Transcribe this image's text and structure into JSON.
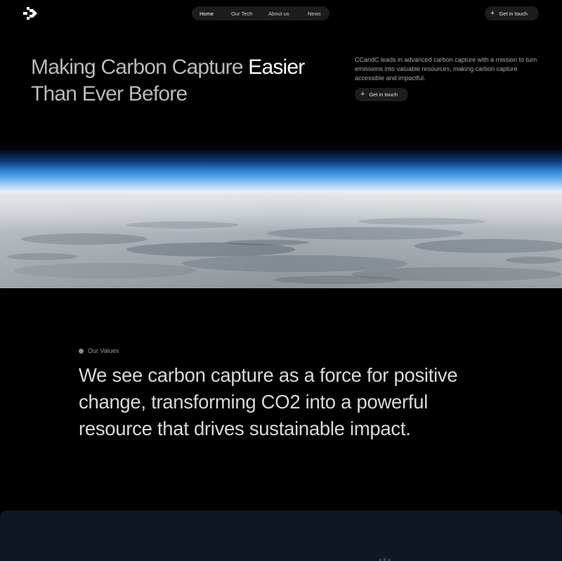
{
  "brand": {
    "logo_icon": "arrow-logo-icon"
  },
  "nav": {
    "items": [
      {
        "label": "Home",
        "active": true
      },
      {
        "label": "Our Tech",
        "active": false
      },
      {
        "label": "About us",
        "active": false
      },
      {
        "label": "News",
        "active": false
      }
    ],
    "cta_label": "Get in touch",
    "cta_icon": "plus-icon"
  },
  "hero": {
    "title_part1": "Making Carbon Capture ",
    "title_accent": "Easier",
    "title_part2": " Than Ever Before",
    "description": "CCandC leads in advanced carbon capture with a mission to turn emissions into valuable resources, making carbon capture accessible and impactful.",
    "cta_label": "Get in touch"
  },
  "values": {
    "label": "Our Values",
    "statement": "We see carbon capture as a force for positive change, transforming CO2 into a powerful resource that drives sustainable impact."
  },
  "colors": {
    "background": "#000000",
    "pill": "#1c1c1c",
    "atmosphere": "#3a8fe0",
    "panel": "#0e1823"
  }
}
